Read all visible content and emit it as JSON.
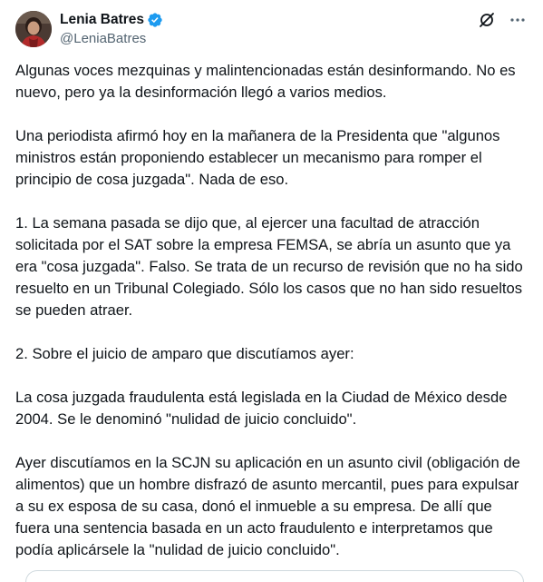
{
  "author": {
    "display_name": "Lenia Batres",
    "handle": "@LeniaBatres",
    "verified": true,
    "verified_color": "#1d9bf0",
    "avatar_icon": "profile-photo"
  },
  "header_actions": {
    "grok_icon": "grok-icon",
    "more_icon": "more-icon"
  },
  "tweet": {
    "paragraphs": [
      "Algunas voces mezquinas y malintencionadas están desinformando. No es nuevo, pero ya la desinformación llegó a varios medios.",
      "Una periodista afirmó hoy en la mañanera de la Presidenta que \"algunos ministros están proponiendo establecer un mecanismo para romper el principio de cosa juzgada\". Nada de eso.",
      "1. La semana pasada se dijo que, al ejercer una facultad de atracción solicitada por el SAT sobre la empresa FEMSA, se abría un asunto que ya era \"cosa juzgada\". Falso. Se trata de un recurso de revisión que no ha sido resuelto en un Tribunal Colegiado. Sólo los casos que no han sido resueltos se pueden atraer.",
      "2. Sobre el juicio de amparo que discutíamos ayer:",
      "La cosa juzgada fraudulenta está legislada en la Ciudad de México desde 2004. Se le denominó \"nulidad de juicio concluido\".",
      "Ayer discutíamos en la SCJN su aplicación en un asunto civil (obligación de alimentos) que un hombre disfrazó de asunto mercantil, pues para expulsar a su ex esposa de su casa, donó el inmueble a su empresa. De allí que fuera una sentencia basada en un acto fraudulento e interpretamos que podía aplicársele la \"nulidad de juicio concluido\"."
    ]
  }
}
